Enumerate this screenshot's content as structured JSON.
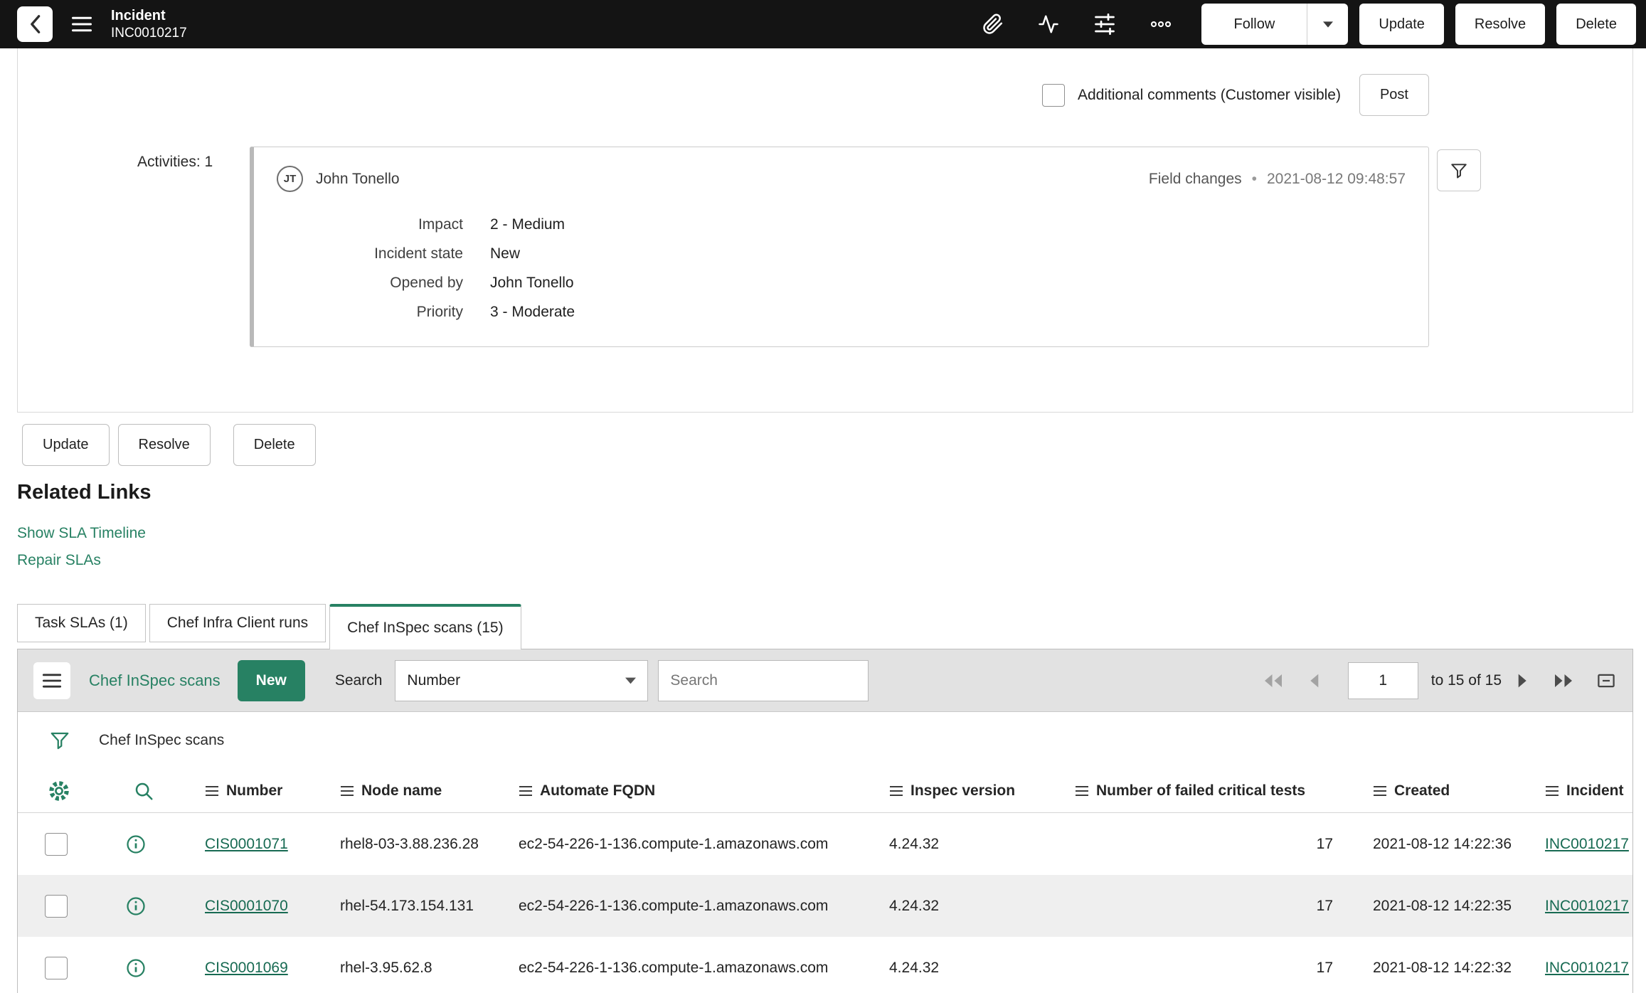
{
  "colors": {
    "accent": "#278163",
    "record_link": "#176a52",
    "topbar_bg": "#141414"
  },
  "header": {
    "title": "Incident",
    "record_number": "INC0010217",
    "follow_label": "Follow",
    "update_label": "Update",
    "resolve_label": "Resolve",
    "delete_label": "Delete"
  },
  "comments": {
    "checkbox_label": "Additional comments (Customer visible)",
    "post_label": "Post"
  },
  "activity": {
    "count_label": "Activities: 1",
    "avatar_initials": "JT",
    "author": "John Tonello",
    "meta_type": "Field changes",
    "meta_separator": "•",
    "meta_time": "2021-08-12 09:48:57",
    "fields": [
      {
        "label": "Impact",
        "value": "2 - Medium"
      },
      {
        "label": "Incident state",
        "value": "New"
      },
      {
        "label": "Opened by",
        "value": "John Tonello"
      },
      {
        "label": "Priority",
        "value": "3 - Moderate"
      }
    ]
  },
  "footer_buttons": {
    "update": "Update",
    "resolve": "Resolve",
    "delete": "Delete"
  },
  "related_links": {
    "heading": "Related Links",
    "link1": "Show SLA Timeline",
    "link2": "Repair SLAs"
  },
  "tabs": [
    {
      "label": "Task SLAs (1)",
      "active": false
    },
    {
      "label": "Chef Infra Client runs",
      "active": false
    },
    {
      "label": "Chef InSpec scans (15)",
      "active": true
    }
  ],
  "list": {
    "title": "Chef InSpec scans",
    "new_button": "New",
    "search_label": "Search",
    "search_field": "Number",
    "search_placeholder": "Search",
    "pagination": {
      "page": "1",
      "range": "to 15 of 15"
    },
    "breadcrumb": "Chef InSpec scans",
    "columns": [
      "Number",
      "Node name",
      "Automate FQDN",
      "Inspec version",
      "Number of failed critical tests",
      "Created",
      "Incident"
    ],
    "rows": [
      {
        "number": "CIS0001071",
        "node_name": "rhel8-03-3.88.236.28",
        "automate_fqdn": "ec2-54-226-1-136.compute-1.amazonaws.com",
        "inspec_version": "4.24.32",
        "failed_tests": "17",
        "created": "2021-08-12 14:22:36",
        "incident": "INC0010217"
      },
      {
        "number": "CIS0001070",
        "node_name": "rhel-54.173.154.131",
        "automate_fqdn": "ec2-54-226-1-136.compute-1.amazonaws.com",
        "inspec_version": "4.24.32",
        "failed_tests": "17",
        "created": "2021-08-12 14:22:35",
        "incident": "INC0010217"
      },
      {
        "number": "CIS0001069",
        "node_name": "rhel-3.95.62.8",
        "automate_fqdn": "ec2-54-226-1-136.compute-1.amazonaws.com",
        "inspec_version": "4.24.32",
        "failed_tests": "17",
        "created": "2021-08-12 14:22:32",
        "incident": "INC0010217"
      }
    ]
  }
}
